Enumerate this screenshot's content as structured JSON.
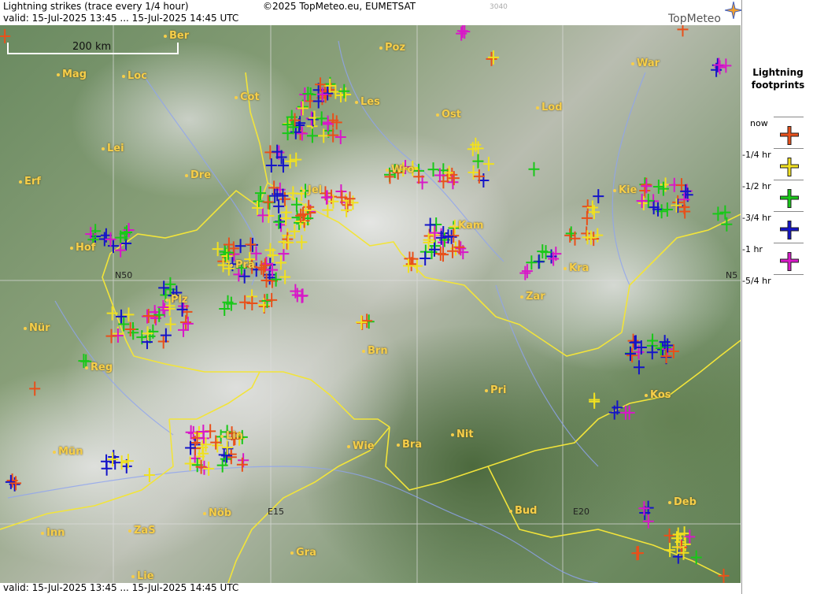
{
  "header": {
    "title": "Lightning strikes (trace every 1/4 hour)",
    "validity": "valid:  15-Jul-2025 13:45 ... 15-Jul-2025 14:45 UTC",
    "copyright": "©2025 TopMeteo.eu, EUMETSAT",
    "code": "3040",
    "brand": "TopMeteo"
  },
  "footer": {
    "validity": "valid:  15-Jul-2025 13:45 ... 15-Jul-2025 14:45 UTC"
  },
  "scale_bar": {
    "label": "200 km"
  },
  "grid_labels": {
    "n50_left": "N50",
    "n50_right": "N5",
    "e15": "E15",
    "e20": "E20"
  },
  "cities": [
    "Ber",
    "Poz",
    "War",
    "Mag",
    "Loc",
    "Cot",
    "Les",
    "Lod",
    "Ost",
    "Lei",
    "Dre",
    "Erf",
    "Wro",
    "Kie",
    "Jel",
    "Kam",
    "Hof",
    "Pra",
    "Kra",
    "Plz",
    "Zar",
    "Nür",
    "Brn",
    "Reg",
    "Pri",
    "Kos",
    "Lin",
    "Mün",
    "Wie",
    "Bra",
    "Nit",
    "Nöb",
    "Bud",
    "Deb",
    "Inn",
    "ZaS",
    "Gra",
    "Lie"
  ],
  "legend": {
    "title_line1": "Lightning",
    "title_line2": "footprints",
    "items": [
      {
        "label": "now",
        "color": "#e8501a"
      },
      {
        "label": "-1/4 hr",
        "color": "#f0e020"
      },
      {
        "label": "-1/2 hr",
        "color": "#18c818"
      },
      {
        "label": "-3/4 hr",
        "color": "#1414c8"
      },
      {
        "label": "-1 hr",
        "color": "#d818c8"
      },
      {
        "label": "-5/4 hr",
        "color": ""
      }
    ]
  },
  "colors": {
    "now": "#e8501a",
    "q1": "#f0e020",
    "q2": "#18c818",
    "q3": "#1414c8",
    "q4": "#d818c8",
    "city": "#f6ce4a",
    "border": "#f2e43a",
    "river": "#8fa4f0"
  }
}
